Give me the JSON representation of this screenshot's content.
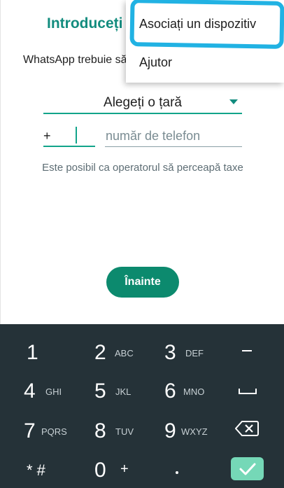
{
  "screen": {
    "title": "Introduceți n",
    "subtitle": "WhatsApp trebuie să",
    "country_select": "Alegeți o țară",
    "country_code_prefix": "+",
    "phone_placeholder": "număr de telefon",
    "notice": "Este posibil ca operatorul să perceapă taxe",
    "next_button": "Înainte"
  },
  "menu": {
    "items": [
      {
        "label": "Asociați un dispozitiv"
      },
      {
        "label": "Ajutor"
      }
    ],
    "highlight_color": "#21b2e3"
  },
  "keypad": {
    "keys": [
      {
        "num": "1",
        "letters": ""
      },
      {
        "num": "2",
        "letters": "ABC"
      },
      {
        "num": "3",
        "letters": "DEF"
      },
      {
        "num": "4",
        "letters": "GHI"
      },
      {
        "num": "5",
        "letters": "JKL"
      },
      {
        "num": "6",
        "letters": "MNO"
      },
      {
        "num": "7",
        "letters": "PQRS"
      },
      {
        "num": "8",
        "letters": "TUV"
      },
      {
        "num": "9",
        "letters": "WXYZ"
      },
      {
        "num": "* #",
        "letters": ""
      },
      {
        "num": "0",
        "letters": "+"
      },
      {
        "num": ".",
        "letters": ""
      }
    ],
    "side_keys": [
      "minus-icon",
      "space-icon",
      "backspace-icon",
      "checkmark-icon"
    ]
  },
  "colors": {
    "accent": "#128c7e",
    "button": "#0c8a6e",
    "keypad_bg": "#253238",
    "confirm_key": "#75d8b7"
  }
}
